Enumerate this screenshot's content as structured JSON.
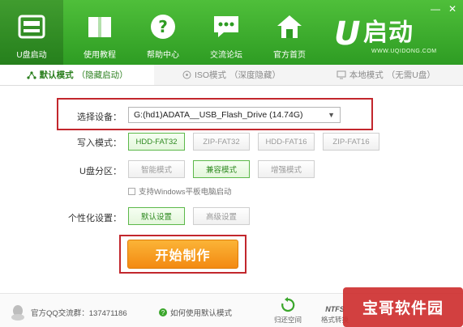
{
  "window": {
    "minimize": "—",
    "close": "✕"
  },
  "nav": [
    {
      "label": "U盘启动",
      "icon": "usb-drive-icon",
      "active": true
    },
    {
      "label": "使用教程",
      "icon": "book-icon",
      "active": false
    },
    {
      "label": "帮助中心",
      "icon": "question-icon",
      "active": false
    },
    {
      "label": "交流论坛",
      "icon": "chat-bubble-icon",
      "active": false
    },
    {
      "label": "官方首页",
      "icon": "home-icon",
      "active": false
    }
  ],
  "brand": {
    "letter": "U",
    "name": "启动",
    "url": "WWW.UQIDONG.COM"
  },
  "mode_tabs": [
    {
      "label": "默认模式",
      "sub": "（隐藏启动）",
      "icon": "share-icon",
      "active": true
    },
    {
      "label": "ISO模式",
      "sub": "（深度隐藏）",
      "icon": "disc-icon",
      "active": false
    },
    {
      "label": "本地模式",
      "sub": "（无需U盘）",
      "icon": "monitor-icon",
      "active": false
    }
  ],
  "form": {
    "device_label": "选择设备：",
    "device_value": "G:(hd1)ADATA__USB_Flash_Drive (14.74G)",
    "write_label": "写入模式：",
    "write_options": [
      "HDD-FAT32",
      "ZIP-FAT32",
      "HDD-FAT16",
      "ZIP-FAT16"
    ],
    "partition_label": "U盘分区：",
    "partition_options": [
      "智能模式",
      "兼容模式",
      "增强模式"
    ],
    "checkbox_label": "支持Windows平板电脑启动",
    "personal_label": "个性化设置：",
    "personal_options": [
      "默认设置",
      "高级设置"
    ],
    "start_label": "开始制作"
  },
  "footer": {
    "qq_text": "官方QQ交流群：137471186",
    "help_text": "如何使用默认模式",
    "tools": [
      {
        "label": "归还空间",
        "icon": "restore-icon"
      },
      {
        "label": "格式转换",
        "icon": "ntfs-icon",
        "badge": "NTFS"
      }
    ]
  },
  "watermark": "宝哥软件园",
  "colors": {
    "header_green": "#3aa62b",
    "accent_red": "#c2272d",
    "start_orange": "#f7a024"
  }
}
